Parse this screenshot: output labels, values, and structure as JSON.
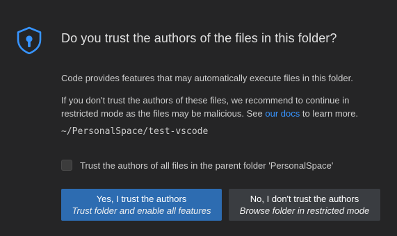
{
  "dialog": {
    "title": "Do you trust the authors of the files in this folder?",
    "paragraph1": "Code provides features that may automatically execute files in this folder.",
    "paragraph2_before_link": "If you don't trust the authors of these files, we recommend to continue in restricted mode as the files may be malicious. See ",
    "paragraph2_link": "our docs",
    "paragraph2_after_link": " to learn more.",
    "folder_path": "~/PersonalSpace/test-vscode",
    "checkbox_label": "Trust the authors of all files in the parent folder 'PersonalSpace'",
    "checkbox_checked": false,
    "icon": "shield-keyhole-icon",
    "accent_color": "#3794ff",
    "buttons": {
      "yes": {
        "label": "Yes, I trust the authors",
        "sublabel": "Trust folder and enable all features",
        "color": "#2d6cb1"
      },
      "no": {
        "label": "No, I don't trust the authors",
        "sublabel": "Browse folder in restricted mode",
        "color": "#3a3d41"
      }
    }
  }
}
